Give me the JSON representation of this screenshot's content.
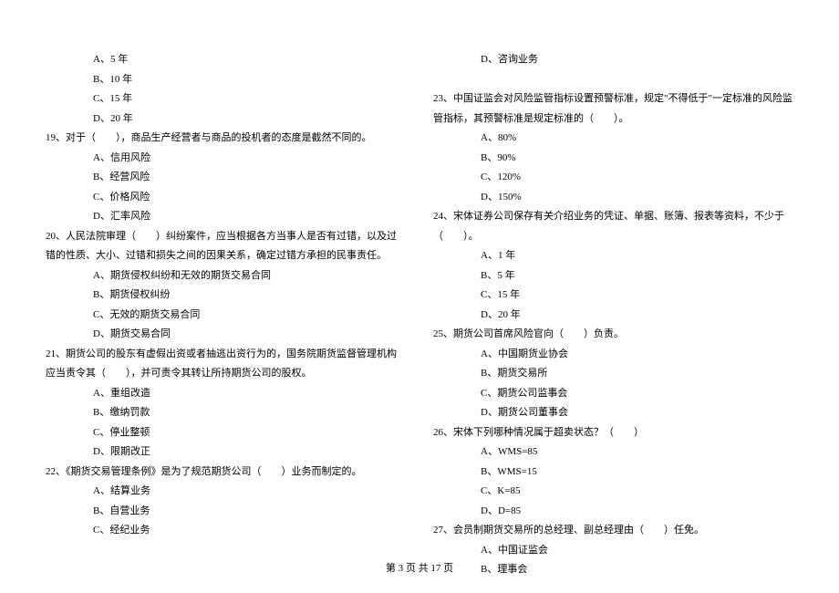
{
  "left": {
    "q18_opts": [
      "A、5 年",
      "B、10 年",
      "C、15 年",
      "D、20 年"
    ],
    "q19": "19、对于（　　），商品生产经营者与商品的投机者的态度是截然不同的。",
    "q19_opts": [
      "A、信用风险",
      "B、经营风险",
      "C、价格风险",
      "D、汇率风险"
    ],
    "q20": "20、人民法院审理（　　）纠纷案件，应当根据各方当事人是否有过错，以及过错的性质、大小、过错和损失之间的因果关系，确定过错方承担的民事责任。",
    "q20_opts": [
      "A、期货侵权纠纷和无效的期货交易合同",
      "B、期货侵权纠纷",
      "C、无效的期货交易合同",
      "D、期货交易合同"
    ],
    "q21": "21、期货公司的股东有虚假出资或者抽逃出资行为的，国务院期货监督管理机构应当责令其（　　），并可责令其转让所持期货公司的股权。",
    "q21_opts": [
      "A、重组改造",
      "B、缴纳罚款",
      "C、停业整顿",
      "D、限期改正"
    ],
    "q22": "22、《期货交易管理条例》是为了规范期货公司（　　）业务而制定的。",
    "q22_opts": [
      "A、结算业务",
      "B、自营业务",
      "C、经纪业务"
    ]
  },
  "right": {
    "q22_opt_d": "D、咨询业务",
    "q23": "23、中国证监会对风险监管指标设置预警标准，规定\"不得低于\"一定标准的风险监管指标，其预警标准是规定标准的（　　）。",
    "q23_opts": [
      "A、80%",
      "B、90%",
      "C、120%",
      "D、150%"
    ],
    "q24": "24、宋体证券公司保存有关介绍业务的凭证、单据、账簿、报表等资料，不少于（　　）。",
    "q24_opts": [
      "A、1 年",
      "B、5 年",
      "C、15 年",
      "D、20 年"
    ],
    "q25": "25、期货公司首席风险官向（　　）负责。",
    "q25_opts": [
      "A、中国期货业协会",
      "B、期货交易所",
      "C、期货公司监事会",
      "D、期货公司董事会"
    ],
    "q26": "26、宋体下列哪种情况属于超卖状态？（　　）",
    "q26_opts": [
      "A、WMS=85",
      "B、WMS=15",
      "C、K=85",
      "D、D=85"
    ],
    "q27": "27、会员制期货交易所的总经理、副总经理由（　　）任免。",
    "q27_opts": [
      "A、中国证监会",
      "B、理事会"
    ]
  },
  "footer": "第 3 页 共 17 页"
}
